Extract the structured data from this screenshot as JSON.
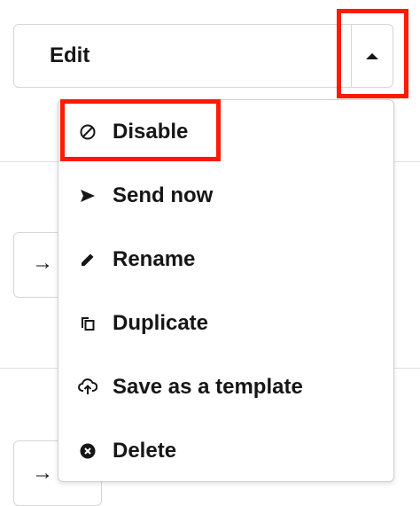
{
  "split_button": {
    "label": "Edit",
    "toggle_icon": "caret-up-icon",
    "expanded": true
  },
  "rows": [
    {
      "icon": "arrow-right-icon",
      "glyph": "→"
    },
    {
      "icon": "arrow-right-icon",
      "glyph": "→"
    }
  ],
  "menu": {
    "items": [
      {
        "label": "Disable",
        "icon": "disable-icon"
      },
      {
        "label": "Send now",
        "icon": "send-icon"
      },
      {
        "label": "Rename",
        "icon": "pencil-icon"
      },
      {
        "label": "Duplicate",
        "icon": "duplicate-icon"
      },
      {
        "label": "Save as a template",
        "icon": "cloud-upload-icon"
      },
      {
        "label": "Delete",
        "icon": "delete-icon"
      }
    ]
  },
  "highlight_color": "#ff1a00"
}
